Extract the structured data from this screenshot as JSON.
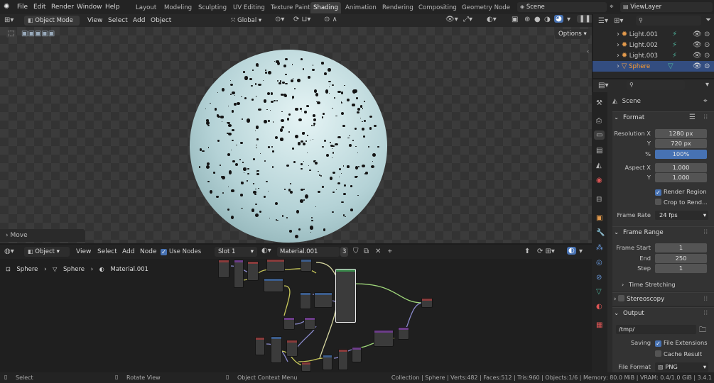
{
  "menubar": {
    "items": [
      "File",
      "Edit",
      "Render",
      "Window",
      "Help"
    ]
  },
  "workspaces": [
    "Layout",
    "Modeling",
    "Sculpting",
    "UV Editing",
    "Texture Paint",
    "Shading",
    "Animation",
    "Rendering",
    "Compositing",
    "Geometry Node"
  ],
  "scene": {
    "name": "Scene",
    "view_layer": "ViewLayer"
  },
  "viewport": {
    "mode": "Object Mode",
    "menus": [
      "View",
      "Select",
      "Add",
      "Object"
    ],
    "transform": "Global",
    "options": "Options",
    "last_op": "Move"
  },
  "node_editor": {
    "object_type": "Object",
    "menus": [
      "View",
      "Select",
      "Add",
      "Node"
    ],
    "use_nodes": "Use Nodes",
    "slot": "Slot 1",
    "material": "Material.001",
    "users": "3",
    "breadcrumb": [
      "Sphere",
      "Sphere",
      "Material.001"
    ]
  },
  "outliner": {
    "rows": [
      {
        "name": "Light.001"
      },
      {
        "name": "Light.002"
      },
      {
        "name": "Light.003"
      },
      {
        "name": "Sphere"
      }
    ]
  },
  "properties": {
    "context": "Scene",
    "format": {
      "title": "Format",
      "res_x_label": "Resolution X",
      "res_x": "1280 px",
      "res_y_label": "Y",
      "res_y": "720 px",
      "pct_label": "%",
      "pct": "100%",
      "asp_x_label": "Aspect X",
      "asp_x": "1.000",
      "asp_y_label": "Y",
      "asp_y": "1.000",
      "render_region": "Render Region",
      "crop": "Crop to Rend...",
      "fps_label": "Frame Rate",
      "fps": "24 fps"
    },
    "frame_range": {
      "title": "Frame Range",
      "start_label": "Frame Start",
      "start": "1",
      "end_label": "End",
      "end": "250",
      "step_label": "Step",
      "step": "1",
      "time_stretching": "Time Stretching"
    },
    "stereoscopy": "Stereoscopy",
    "output": {
      "title": "Output",
      "path": "/tmp/",
      "saving_label": "Saving",
      "file_ext": "File Extensions",
      "cache": "Cache Result",
      "file_format_label": "File Format",
      "file_format": "PNG"
    }
  },
  "statusbar": {
    "select": "Select",
    "rotate": "Rotate View",
    "context_menu": "Object Context Menu",
    "stats": "Collection | Sphere | Verts:482 | Faces:512 | Tris:960 | Objects:1/6 | Memory: 80.0 MiB | VRAM: 0.4/1.0 GiB | 3.4.1"
  },
  "colors": {
    "accent": "#4772b3",
    "selected_row": "#334d80",
    "active_object": "#ff9d2e",
    "sphere": "#c9e2e4"
  }
}
